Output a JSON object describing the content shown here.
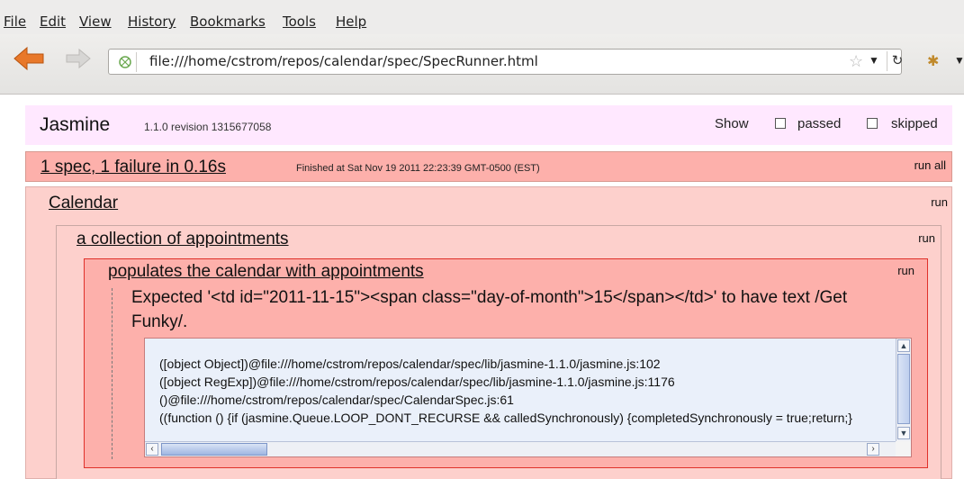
{
  "menu": [
    "File",
    "Edit",
    "View",
    "History",
    "Bookmarks",
    "Tools",
    "Help"
  ],
  "url": "file:///home/cstrom/repos/calendar/spec/SpecRunner.html",
  "jasmine": {
    "brand": "Jasmine",
    "version": "1.1.0 revision 1315677058",
    "show_label": "Show",
    "passed_label": "passed",
    "skipped_label": "skipped",
    "passed_checked": false,
    "skipped_checked": false
  },
  "summary": {
    "text": "1 spec, 1 failure in 0.16s",
    "finished": "Finished at Sat Nov 19 2011 22:23:39 GMT-0500 (EST)",
    "run_all": "run all"
  },
  "suite": {
    "name": "Calendar",
    "run": "run"
  },
  "subsuite": {
    "name": "a collection of appointments",
    "run": "run"
  },
  "spec": {
    "name": "populates the calendar with appointments",
    "run": "run",
    "message": "Expected '<td id=\"2011-11-15\"><span class=\"day-of-month\">15</span></td>' to have text /Get Funky/.",
    "trace": [
      "([object Object])@file:///home/cstrom/repos/calendar/spec/lib/jasmine-1.1.0/jasmine.js:102",
      "([object RegExp])@file:///home/cstrom/repos/calendar/spec/lib/jasmine-1.1.0/jasmine.js:1176",
      "()@file:///home/cstrom/repos/calendar/spec/CalendarSpec.js:61",
      "((function () {if (jasmine.Queue.LOOP_DONT_RECURSE && calledSynchronously) {completedSynchronously = true;return;}"
    ]
  },
  "colors": {
    "header_bg": "#ffe8ff",
    "failure_bg": "#fdb0ab",
    "suite_bg": "#fdd0cc",
    "spec_border": "#e0312a",
    "back_arrow": "#e8782a"
  }
}
